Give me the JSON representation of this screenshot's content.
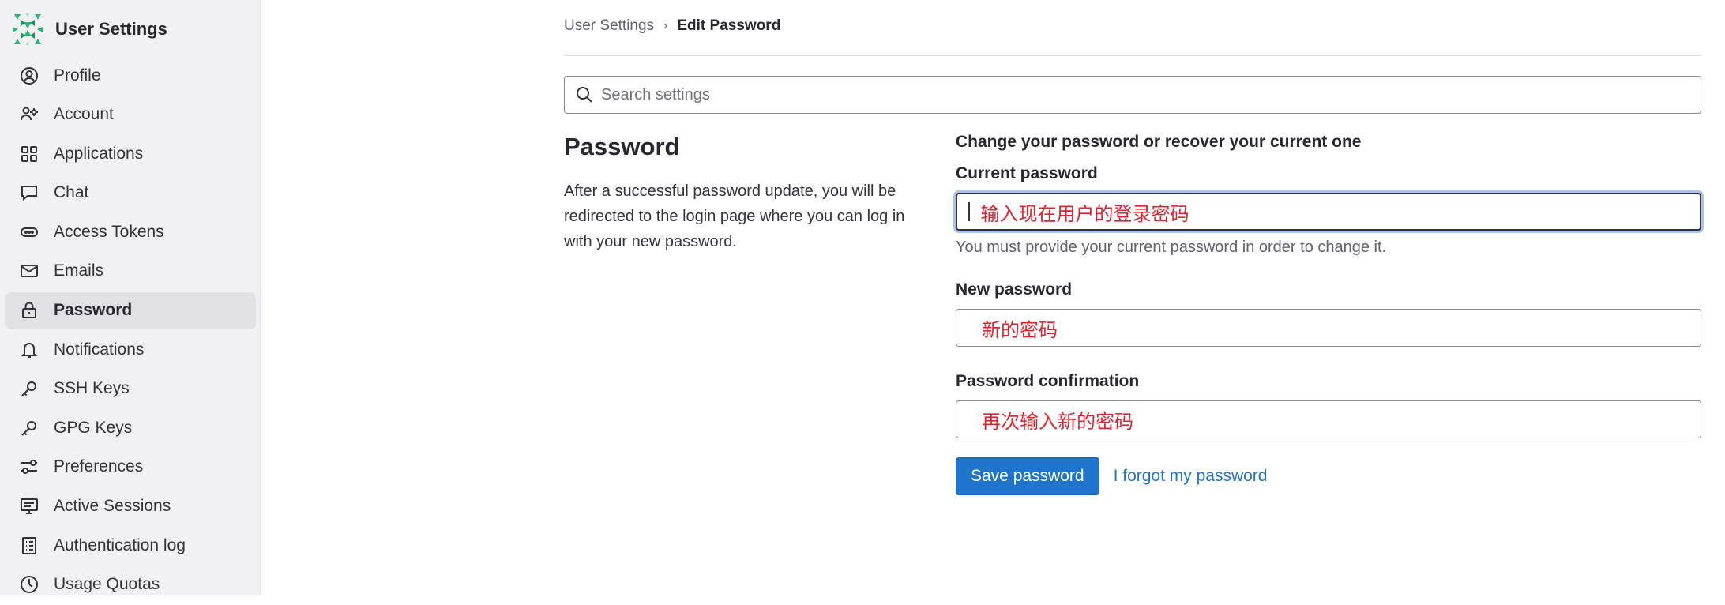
{
  "sidebar": {
    "title": "User Settings",
    "items": [
      {
        "label": "Profile",
        "icon": "profile-icon"
      },
      {
        "label": "Account",
        "icon": "account-icon"
      },
      {
        "label": "Applications",
        "icon": "applications-icon"
      },
      {
        "label": "Chat",
        "icon": "chat-icon"
      },
      {
        "label": "Access Tokens",
        "icon": "token-icon"
      },
      {
        "label": "Emails",
        "icon": "mail-icon"
      },
      {
        "label": "Password",
        "icon": "lock-icon",
        "active": true
      },
      {
        "label": "Notifications",
        "icon": "bell-icon"
      },
      {
        "label": "SSH Keys",
        "icon": "key-icon"
      },
      {
        "label": "GPG Keys",
        "icon": "key-icon"
      },
      {
        "label": "Preferences",
        "icon": "preferences-icon"
      },
      {
        "label": "Active Sessions",
        "icon": "monitor-icon"
      },
      {
        "label": "Authentication log",
        "icon": "log-icon"
      },
      {
        "label": "Usage Quotas",
        "icon": "gauge-icon"
      }
    ]
  },
  "breadcrumb": {
    "parent": "User Settings",
    "current": "Edit Password"
  },
  "search": {
    "placeholder": "Search settings"
  },
  "section": {
    "title": "Password",
    "description": "After a successful password update, you will be redirected to the login page where you can log in with your new password."
  },
  "form": {
    "heading": "Change your password or recover your current one",
    "current_password": {
      "label": "Current password",
      "annotation": "输入现在用户的登录密码",
      "help": "You must provide your current password in order to change it."
    },
    "new_password": {
      "label": "New password",
      "annotation": "新的密码"
    },
    "password_confirmation": {
      "label": "Password confirmation",
      "annotation": "再次输入新的密码"
    },
    "save_label": "Save password",
    "forgot_label": "I forgot my password"
  },
  "colors": {
    "accent": "#1f75cb",
    "annotation": "#e0242f",
    "sidebar_bg": "#f1f1f3"
  }
}
